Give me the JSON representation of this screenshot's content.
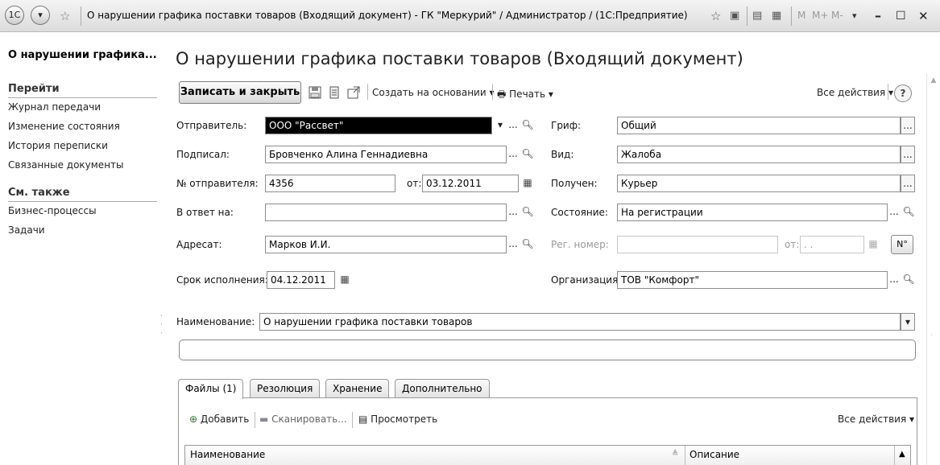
{
  "window": {
    "title": "О нарушении графика поставки товаров (Входящий документ) - ГК \"Меркурий\" / Администратор / (1С:Предприятие)",
    "app_icon": "1c-logo-icon",
    "m_buttons": [
      "M",
      "M+",
      "M-"
    ]
  },
  "sidebar": {
    "title": "О нарушении графика...",
    "goto_header": "Перейти",
    "goto_items": [
      "Журнал передачи",
      "Изменение состояния",
      "История переписки",
      "Связанные документы"
    ],
    "see_also_header": "См. также",
    "see_also_items": [
      "Бизнес-процессы",
      "Задачи"
    ]
  },
  "main": {
    "title": "О нарушении графика поставки товаров (Входящий документ)",
    "toolbar": {
      "save_close": "Записать и закрыть",
      "create_based": "Создать на основании",
      "print": "Печать",
      "all_actions": "Все действия",
      "help": "?"
    },
    "form": {
      "sender_label": "Отправитель:",
      "sender_value": "ООО \"Рассвет\"",
      "signed_label": "Подписал:",
      "signed_value": "Бровченко Алина Геннадиевна",
      "sender_no_label": "№ отправителя:",
      "sender_no_value": "4356",
      "from_label": "от:",
      "from_value": "03.12.2011",
      "reply_to_label": "В ответ на:",
      "reply_to_value": "",
      "addressee_label": "Адресат:",
      "addressee_value": "Марков И.И.",
      "deadline_label": "Срок исполнения:",
      "deadline_value": "04.12.2011",
      "stamp_label": "Гриф:",
      "stamp_value": "Общий",
      "kind_label": "Вид:",
      "kind_value": "Жалоба",
      "received_label": "Получен:",
      "received_value": "Курьер",
      "state_label": "Состояние:",
      "state_value": "На регистрации",
      "reg_no_label": "Рег. номер:",
      "reg_no_value": "",
      "reg_from_label": "от:",
      "reg_from_value": " .  . ",
      "num_button": "N°",
      "org_label": "Организация:",
      "org_value": "ТОВ \"Комфорт\"",
      "name_label": "Наименование:",
      "name_value": "О нарушении графика поставки товаров",
      "comment_value": ""
    },
    "tabs": [
      {
        "label": "Файлы (1)",
        "active": true
      },
      {
        "label": "Резолюция",
        "active": false
      },
      {
        "label": "Хранение",
        "active": false
      },
      {
        "label": "Дополнительно",
        "active": false
      }
    ],
    "files_panel": {
      "add": "Добавить",
      "scan": "Сканировать...",
      "view": "Просмотреть",
      "all_actions": "Все действия",
      "col_name": "Наименование",
      "col_desc": "Описание"
    }
  }
}
